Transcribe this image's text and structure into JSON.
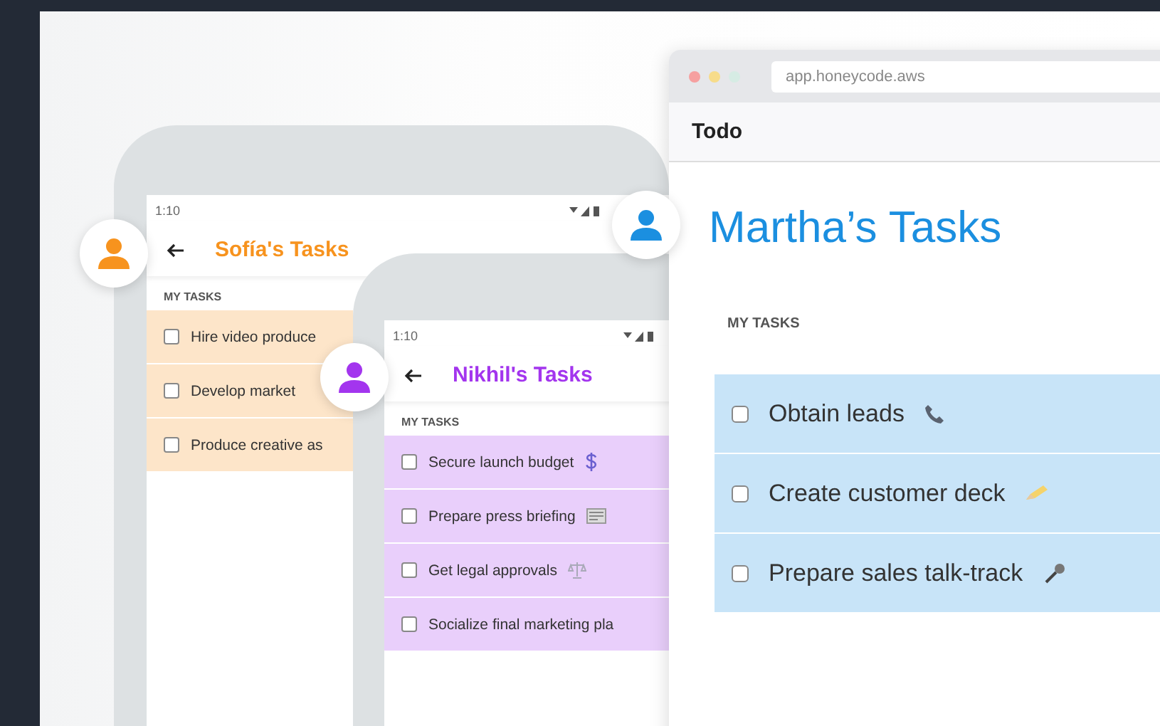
{
  "boards": [
    {
      "kind": "phone",
      "color": "#f7931e",
      "status_time": "1:10",
      "title": "Sofía's Tasks",
      "section": "MY TASKS",
      "tasks": [
        {
          "text": "Hire video produce",
          "checked": false
        },
        {
          "text": "Develop market",
          "checked": false
        },
        {
          "text": "Produce creative as",
          "checked": false
        }
      ]
    },
    {
      "kind": "phone",
      "color": "#a335ee",
      "status_time": "1:10",
      "title": "Nikhil's Tasks",
      "section": "MY TASKS",
      "tasks": [
        {
          "text": "Secure launch budget",
          "checked": false
        },
        {
          "text": "Prepare press briefing",
          "checked": false
        },
        {
          "text": "Get legal approvals",
          "checked": false
        },
        {
          "text": "Socialize final marketing pla",
          "checked": false
        }
      ]
    },
    {
      "kind": "browser",
      "color": "#1b8fe0",
      "url": "app.honeycode.aws",
      "app_name": "Todo",
      "title": "Martha’s Tasks",
      "section": "MY TASKS",
      "tasks": [
        {
          "text": "Obtain leads",
          "checked": false
        },
        {
          "text": "Create customer deck",
          "checked": false
        },
        {
          "text": "Prepare sales talk-track",
          "checked": false
        }
      ]
    }
  ]
}
